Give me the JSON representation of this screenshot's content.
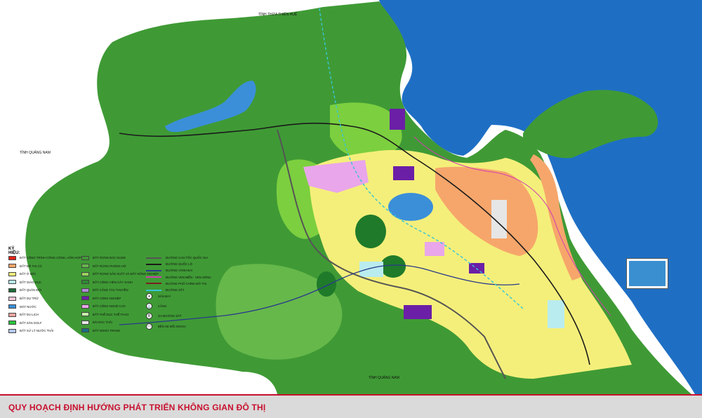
{
  "colors": {
    "sea": "#1e6fc4",
    "forest": "#3f9a35",
    "forest_light": "#7ccf3f",
    "urban_yellow": "#f4ef7a",
    "residential_orange": "#f6a66b",
    "public_red": "#e2231a",
    "industrial_purple": "#6b1fa6",
    "hightech_pink": "#e9a6ea",
    "lake_blue": "#3b8fd9",
    "title_red": "#c8102e"
  },
  "region_labels": {
    "north": "TỈNH THỪA THIÊN HUẾ",
    "west": "TỈNH QUẢNG NAM",
    "south": "TỈNH QUẢNG NAM"
  },
  "legend": {
    "title": "KÝ HIỆU:",
    "land_use": [
      {
        "label": "ĐẤT CÔNG TRÌNH CÔNG CỘNG, HỖN HỢP",
        "color": "#e2231a"
      },
      {
        "label": "ĐẤT ĐÔ THỊ CŨ",
        "color": "#f6a66b"
      },
      {
        "label": "ĐẤT Ở MỚI",
        "color": "#f4ef7a"
      },
      {
        "label": "ĐẤT GIÁO DỤC",
        "color": "#b9ecef"
      },
      {
        "label": "ĐẤT QUÂN ĐỘI",
        "color": "#1f6b3a"
      },
      {
        "label": "ĐẤT DỰ TRỮ",
        "color": "#f5c6d9"
      },
      {
        "label": "MẶT NƯỚC",
        "color": "#3b8fd9"
      },
      {
        "label": "ĐẤT DU LỊCH",
        "color": "#f2a5a0"
      },
      {
        "label": "ĐẤT SÂN GOLF",
        "color": "#28c43a"
      },
      {
        "label": "ĐẤT XỬ LÝ NƯỚC THẢI",
        "color": "#b6c9ef"
      },
      {
        "label": "ĐẤT RỪNG ĐẶC DỤNG",
        "color": "#3f9a35"
      },
      {
        "label": "ĐẤT RỪNG PHÒNG HỘ",
        "color": "#66b84a"
      },
      {
        "label": "ĐẤT RỪNG SẢN XUẤT VÀ ĐẤT NÔNG NGHIỆP",
        "color": "#9ad45c"
      },
      {
        "label": "ĐẤT CÔNG VIÊN CÂY XANH",
        "color": "#2c8b2f"
      },
      {
        "label": "ĐẤT CẢNG TÀU THUYỀN",
        "color": "#b08ad6"
      },
      {
        "label": "ĐẤT CÔNG NGHIỆP",
        "color": "#6b1fa6"
      },
      {
        "label": "ĐẤT CÔNG NGHỆ CAO",
        "color": "#e9a6ea"
      },
      {
        "label": "ĐẤT THỂ DỤC THỂ THAO",
        "color": "#c6f0a8"
      },
      {
        "label": "BÃI RÁC THẢI",
        "color": "#e6e6e6"
      },
      {
        "label": "ĐẤT NGHĨA TRANG",
        "color": "#1a6f86"
      }
    ],
    "infrastructure": [
      {
        "label": "ĐƯỜNG CAO TỐC QUỐC GIA",
        "color": "#555555"
      },
      {
        "label": "ĐƯỜNG QUỐC LỘ",
        "color": "#1a1a1a"
      },
      {
        "label": "ĐƯỜNG VÀNH ĐAI",
        "color": "#2a3a8a"
      },
      {
        "label": "ĐƯỜNG VEN BIỂN - VEN SÔNG",
        "color": "#d23fb0"
      },
      {
        "label": "ĐƯỜNG PHỐ CHÍNH ĐÔ THỊ",
        "color": "#7a1f1f"
      },
      {
        "label": "ĐƯỜNG SẮT",
        "color": "#36c5d6"
      }
    ],
    "symbols": [
      {
        "label": "SÂN BAY",
        "glyph": "✈",
        "icon": "airport-icon"
      },
      {
        "label": "CẢNG",
        "glyph": "⚓",
        "icon": "port-icon"
      },
      {
        "label": "GA ĐƯỜNG SẮT",
        "glyph": "B",
        "icon": "railway-station-icon"
      },
      {
        "label": "BẾN XE ĐỐI NGOẠI",
        "glyph": "▭",
        "icon": "bus-station-icon"
      }
    ]
  },
  "footer": {
    "title": "QUY HOẠCH ĐỊNH HƯỚNG PHÁT TRIỂN KHÔNG GIAN ĐÔ THỊ"
  }
}
